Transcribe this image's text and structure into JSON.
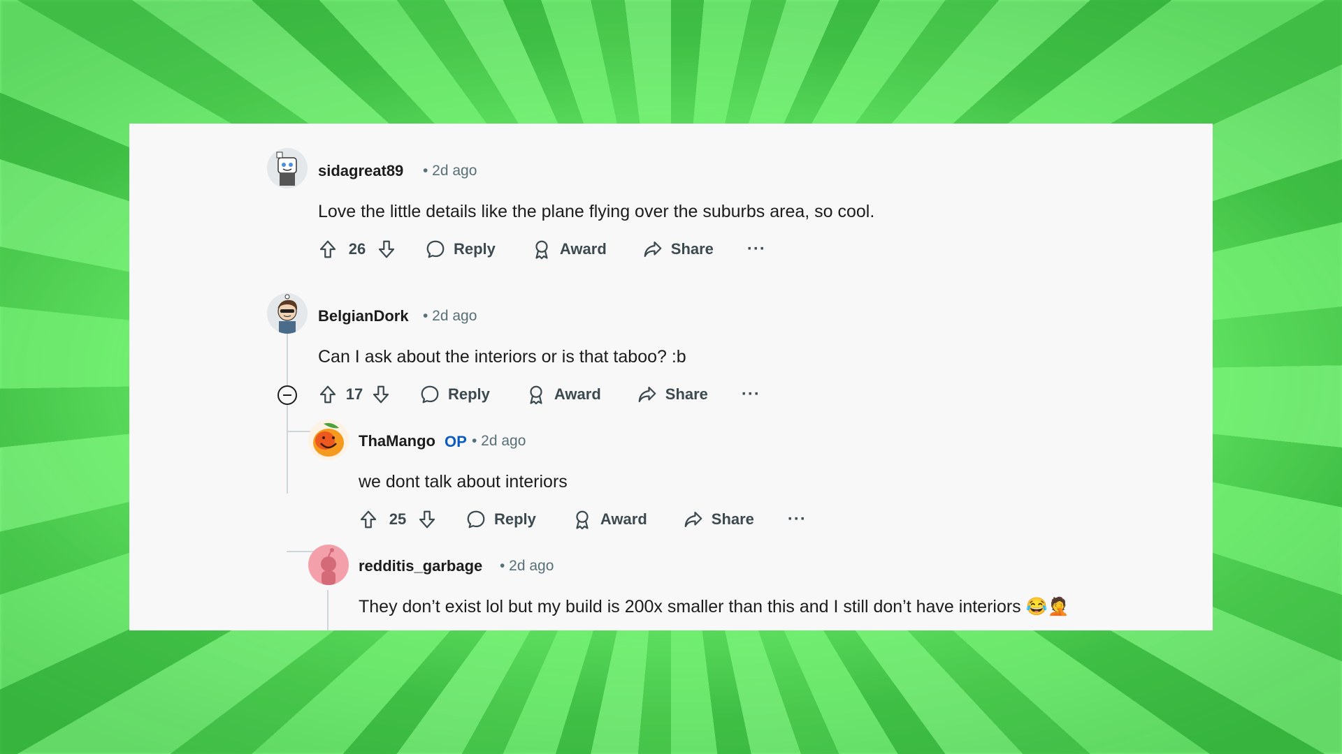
{
  "comments": [
    {
      "username": "sidagreat89",
      "time": "• 2d ago",
      "body": "Love the little details like the plane flying over the suburbs area, so cool.",
      "votes": "26",
      "reply": "Reply",
      "award": "Award",
      "share": "Share",
      "more": "···"
    },
    {
      "username": "BelgianDork",
      "time": "• 2d ago",
      "body": "Can I ask about the interiors or is that taboo? :b",
      "votes": "17",
      "reply": "Reply",
      "award": "Award",
      "share": "Share",
      "more": "···"
    },
    {
      "username": "ThaMango",
      "badge": "OP",
      "time": "• 2d ago",
      "body": "we dont talk about interiors",
      "votes": "25",
      "reply": "Reply",
      "award": "Award",
      "share": "Share",
      "more": "···"
    },
    {
      "username": "redditis_garbage",
      "time": "• 2d ago",
      "body": "They don’t exist lol but my build is 200x smaller than this and I still don’t have interiors 😂🤦"
    }
  ],
  "colors": {
    "background_green": "#6ff06f",
    "panel": "#f8f8f9",
    "op_badge": "#0a5bbf",
    "text": "#1c1c1c",
    "meta": "#576f76"
  },
  "icons": [
    "upvote-icon",
    "downvote-icon",
    "comment-icon",
    "award-icon",
    "share-icon",
    "collapse-icon",
    "more-icon"
  ]
}
